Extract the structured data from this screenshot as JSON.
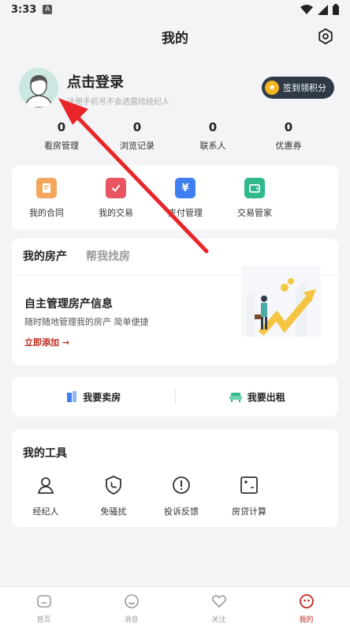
{
  "status": {
    "time": "3:33",
    "notification": "A"
  },
  "header": {
    "title": "我的"
  },
  "profile": {
    "login_title": "点击登录",
    "login_subtitle": "注册手机号不会透露给经纪人",
    "sign_button": "签到领积分"
  },
  "stats": [
    {
      "value": "0",
      "label": "看房管理"
    },
    {
      "value": "0",
      "label": "浏览记录"
    },
    {
      "value": "0",
      "label": "联系人"
    },
    {
      "value": "0",
      "label": "优惠券"
    }
  ],
  "services": [
    {
      "label": "我的合同",
      "color": "#f2a35a"
    },
    {
      "label": "我的交易",
      "color": "#e8545f"
    },
    {
      "label": "支付管理",
      "color": "#3e7ef0"
    },
    {
      "label": "交易管家",
      "color": "#2fb98c"
    }
  ],
  "property": {
    "tabs": [
      "我的房产",
      "帮我找房"
    ],
    "title": "自主管理房产信息",
    "subtitle": "随时随地管理我的房产 简单便捷",
    "link": "立即添加 →"
  },
  "sellrent": {
    "sell": "我要卖房",
    "rent": "我要出租"
  },
  "tools": {
    "title": "我的工具",
    "items": [
      "经纪人",
      "免骚扰",
      "投诉反馈",
      "房贷计算"
    ]
  },
  "nav": [
    {
      "label": "首页"
    },
    {
      "label": "消息"
    },
    {
      "label": "关注"
    },
    {
      "label": "我的"
    }
  ],
  "colors": {
    "accent": "#c2271e",
    "sign_bg": "#2f3a48",
    "arrow": "#e8262a"
  }
}
